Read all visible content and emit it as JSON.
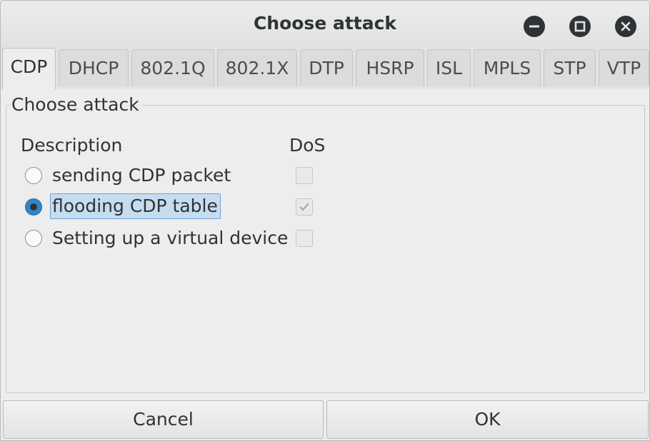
{
  "window": {
    "title": "Choose attack"
  },
  "tabs": [
    {
      "label": "CDP",
      "active": true
    },
    {
      "label": "DHCP",
      "active": false
    },
    {
      "label": "802.1Q",
      "active": false
    },
    {
      "label": "802.1X",
      "active": false
    },
    {
      "label": "DTP",
      "active": false
    },
    {
      "label": "HSRP",
      "active": false
    },
    {
      "label": "ISL",
      "active": false
    },
    {
      "label": "MPLS",
      "active": false
    },
    {
      "label": "STP",
      "active": false
    },
    {
      "label": "VTP",
      "active": false
    }
  ],
  "panel": {
    "legend": "Choose attack",
    "headers": {
      "description": "Description",
      "dos": "DoS"
    },
    "options": [
      {
        "label": "sending CDP packet",
        "selected": false,
        "dos": false
      },
      {
        "label": "flooding CDP table",
        "selected": true,
        "dos": true
      },
      {
        "label": "Setting up a virtual device",
        "selected": false,
        "dos": false
      }
    ]
  },
  "buttons": {
    "cancel": "Cancel",
    "ok": "OK"
  },
  "icons": {
    "minimize": "minimize-icon",
    "maximize": "maximize-icon",
    "close": "close-icon"
  }
}
